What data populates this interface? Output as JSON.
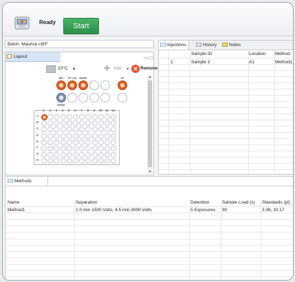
{
  "toolbar": {
    "status": "Ready",
    "start_label": "Start"
  },
  "batch": {
    "label": "Batch: Maurice cIEF"
  },
  "layout": {
    "tab_label": "Layout",
    "temperature": "10°C",
    "add_label": "Add",
    "remove_label": "Remove",
    "vial_labels": {
      "mc": "MC",
      "pi_cal": "PI Cal",
      "water_top": "Water",
      "air": "Air",
      "water_bottom": "Water"
    },
    "plate_columns": [
      "1",
      "2",
      "3",
      "4",
      "5",
      "6",
      "7",
      "8",
      "9",
      "10",
      "11",
      "12"
    ],
    "plate_rows": [
      "A",
      "B",
      "C",
      "D",
      "E",
      "F",
      "G",
      "H"
    ]
  },
  "injections": {
    "tabs": [
      "Injections",
      "History",
      "Notes"
    ],
    "headers": [
      "Sample ID",
      "Location",
      "Method"
    ],
    "rows": [
      {
        "num": "1",
        "sample_id": "Sample 1",
        "location": "A1",
        "method": "Method1"
      }
    ]
  },
  "methods": {
    "tab_label": "Methods",
    "headers": [
      "Name",
      "Separation",
      "Detection",
      "Sample Load (s)",
      "Standards (pl)"
    ],
    "rows": [
      {
        "name": "Method1",
        "separation": "1.0 min 1500 Volts, 4.5 min 3000 Volts",
        "detection": "5 Exposures",
        "sample_load": "90",
        "standards": "3.38, 10.17"
      }
    ]
  },
  "colors": {
    "start": "#3a9f56",
    "accent_orange": "#e05f22",
    "tab_blue": "#d6e6f7"
  }
}
